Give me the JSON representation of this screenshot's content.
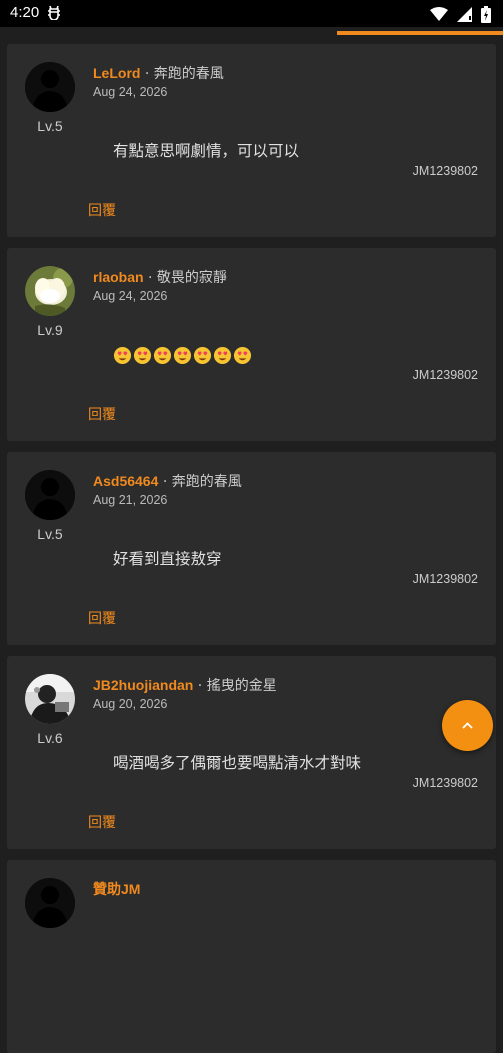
{
  "status_bar": {
    "time": "4:20",
    "notification_icon": "bug-icon",
    "icons": [
      "wifi-icon",
      "signal-icon",
      "battery-charging-icon"
    ]
  },
  "scroll_progress": {
    "fraction": 0.33,
    "color": "#f08a1e"
  },
  "accent_color": "#f08a1e",
  "comments": [
    {
      "username": "LeLord",
      "separator": " · ",
      "rank": "奔跑的春風",
      "date": "Aug 24, 2026",
      "level": "Lv.5",
      "content": "有點意思啊劇情，可以可以",
      "emoji_count": 0,
      "code": "JM1239802",
      "reply_label": "回覆",
      "avatar": "silhouette"
    },
    {
      "username": "rlaoban",
      "separator": " · ",
      "rank": "敬畏的寂靜",
      "date": "Aug 24, 2026",
      "level": "Lv.9",
      "content": "",
      "emoji_count": 7,
      "code": "JM1239802",
      "reply_label": "回覆",
      "avatar": "flower"
    },
    {
      "username": "Asd56464",
      "separator": " · ",
      "rank": "奔跑的春風",
      "date": "Aug 21, 2026",
      "level": "Lv.5",
      "content": "好看到直接敖穿",
      "emoji_count": 0,
      "code": "JM1239802",
      "reply_label": "回覆",
      "avatar": "silhouette"
    },
    {
      "username": "JB2huojiandan",
      "separator": " · ",
      "rank": "搖曳的金星",
      "date": "Aug 20, 2026",
      "level": "Lv.6",
      "content": "喝酒喝多了偶爾也要喝點清水才對味",
      "emoji_count": 0,
      "code": "JM1239802",
      "reply_label": "回覆",
      "avatar": "photo"
    },
    {
      "username": "贊助JM",
      "separator": "",
      "rank": "",
      "date": "",
      "level": "",
      "content": "",
      "emoji_count": 0,
      "code": "",
      "reply_label": "",
      "avatar": "silhouette"
    }
  ],
  "scroll_top_button": {
    "icon": "chevron-up-icon"
  }
}
